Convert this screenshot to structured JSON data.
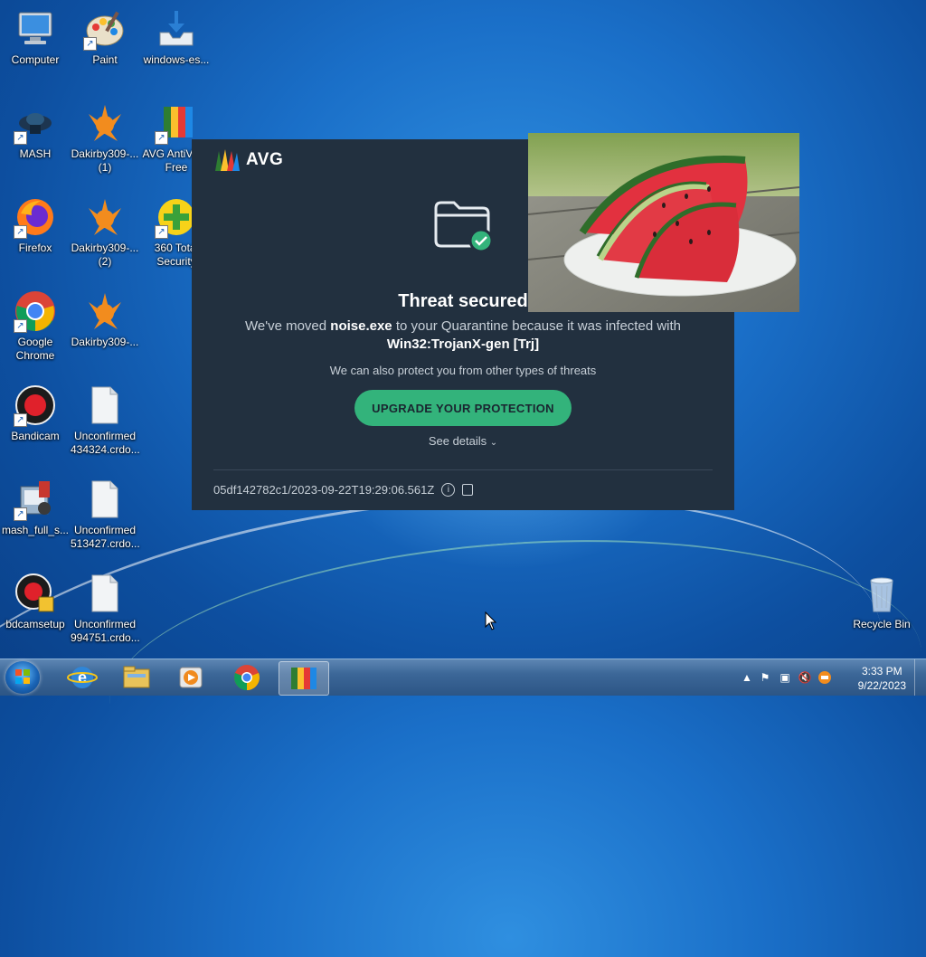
{
  "desktop": {
    "icons": [
      {
        "label": "Computer"
      },
      {
        "label": "Paint"
      },
      {
        "label": "windows-es..."
      },
      {
        "label": "MASH"
      },
      {
        "label": "Dakirby309-... (1)"
      },
      {
        "label": "AVG AntiVirus Free"
      },
      {
        "label": "Firefox"
      },
      {
        "label": "Dakirby309-... (2)"
      },
      {
        "label": "360 Total Security"
      },
      {
        "label": "Google Chrome"
      },
      {
        "label": "Dakirby309-..."
      },
      {
        "label": "Bandicam"
      },
      {
        "label": "Unconfirmed 434324.crdo..."
      },
      {
        "label": "mash_full_s..."
      },
      {
        "label": "Unconfirmed 513427.crdo..."
      },
      {
        "label": "bdcamsetup"
      },
      {
        "label": "Unconfirmed 994751.crdo..."
      },
      {
        "label": "Recycle Bin"
      }
    ]
  },
  "avg_dialog": {
    "brand": "AVG",
    "headline": "Threat secured",
    "message_prefix": "We've moved",
    "file_name": "noise.exe",
    "message_suffix": "to your Quarantine because it was infected with",
    "threat_name": "Win32:TrojanX-gen [Trj]",
    "secondary_message": "We can also protect you from other types of threats",
    "upgrade_label": "UPGRADE YOUR PROTECTION",
    "details_label": "See details",
    "incident_id": "05df142782c1/2023-09-22T19:29:06.561Z",
    "accent_color": "#33b37b",
    "background_color": "#22303f"
  },
  "taskbar": {
    "pinned": [
      "start-button",
      "internet-explorer",
      "windows-explorer",
      "media-player",
      "google-chrome",
      "avg"
    ],
    "clock_time": "3:33 PM",
    "clock_date": "9/22/2023"
  }
}
